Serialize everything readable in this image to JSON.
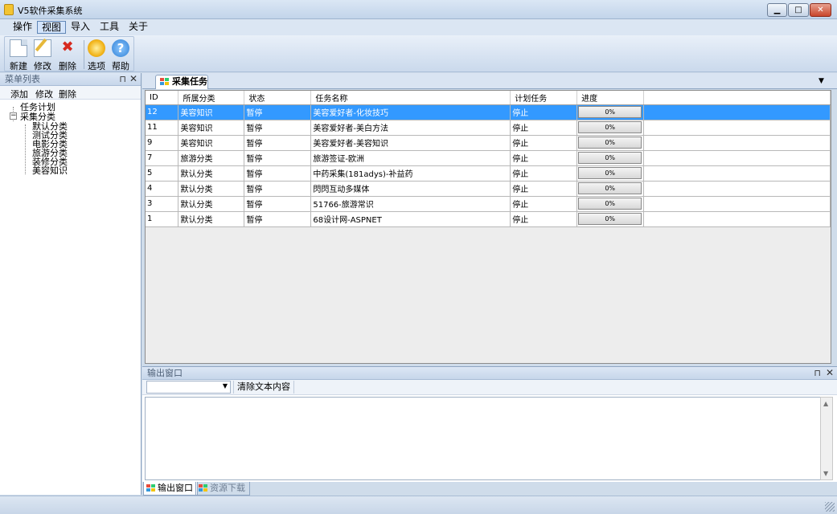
{
  "window": {
    "title": "V5软件采集系统",
    "min": "▁",
    "max": "□",
    "close": "✕"
  },
  "menu": [
    {
      "label": "操作"
    },
    {
      "label": "视图"
    },
    {
      "label": "导入"
    },
    {
      "label": "工具"
    },
    {
      "label": "关于"
    }
  ],
  "toolbar": {
    "new": "新建",
    "edit": "修改",
    "delete": "删除",
    "options": "选项",
    "help": "帮助"
  },
  "sidebar": {
    "title": "菜单列表",
    "pin": "⊓",
    "close": "✕",
    "actions": {
      "add": "添加",
      "edit": "修改",
      "delete": "删除"
    },
    "tree": {
      "root1": "任务计划",
      "root2": "采集分类",
      "expander": "−",
      "children": [
        "默认分类",
        "测试分类",
        "电影分类",
        "旅游分类",
        "装修分类",
        "美容知识"
      ]
    }
  },
  "main": {
    "tab": "采集任务",
    "dropdown": "▼",
    "columns": {
      "id": "ID",
      "category": "所属分类",
      "status": "状态",
      "name": "任务名称",
      "plan": "计划任务",
      "progress": "进度"
    },
    "rows": [
      {
        "id": "12",
        "category": "美容知识",
        "status": "暂停",
        "name": "美容爱好者-化妆技巧",
        "plan": "停止",
        "progress": "0%"
      },
      {
        "id": "11",
        "category": "美容知识",
        "status": "暂停",
        "name": "美容爱好者-美白方法",
        "plan": "停止",
        "progress": "0%"
      },
      {
        "id": "9",
        "category": "美容知识",
        "status": "暂停",
        "name": "美容爱好者-美容知识",
        "plan": "停止",
        "progress": "0%"
      },
      {
        "id": "7",
        "category": "旅游分类",
        "status": "暂停",
        "name": "旅游签证-欧洲",
        "plan": "停止",
        "progress": "0%"
      },
      {
        "id": "5",
        "category": "默认分类",
        "status": "暂停",
        "name": "中药采集(181adys)-补益药",
        "plan": "停止",
        "progress": "0%"
      },
      {
        "id": "4",
        "category": "默认分类",
        "status": "暂停",
        "name": "閃閃互动多媒体",
        "plan": "停止",
        "progress": "0%"
      },
      {
        "id": "3",
        "category": "默认分类",
        "status": "暂停",
        "name": "51766-旅游常识",
        "plan": "停止",
        "progress": "0%"
      },
      {
        "id": "1",
        "category": "默认分类",
        "status": "暂停",
        "name": "68设计网-ASPNET",
        "plan": "停止",
        "progress": "0%"
      }
    ]
  },
  "output": {
    "title": "输出窗口",
    "pin": "⊓",
    "close": "✕",
    "select_arrow": "▼",
    "clear": "清除文本内容",
    "scroll_up": "▲",
    "scroll_down": "▼",
    "tabs": {
      "output": "输出窗口",
      "download": "资源下载"
    }
  }
}
